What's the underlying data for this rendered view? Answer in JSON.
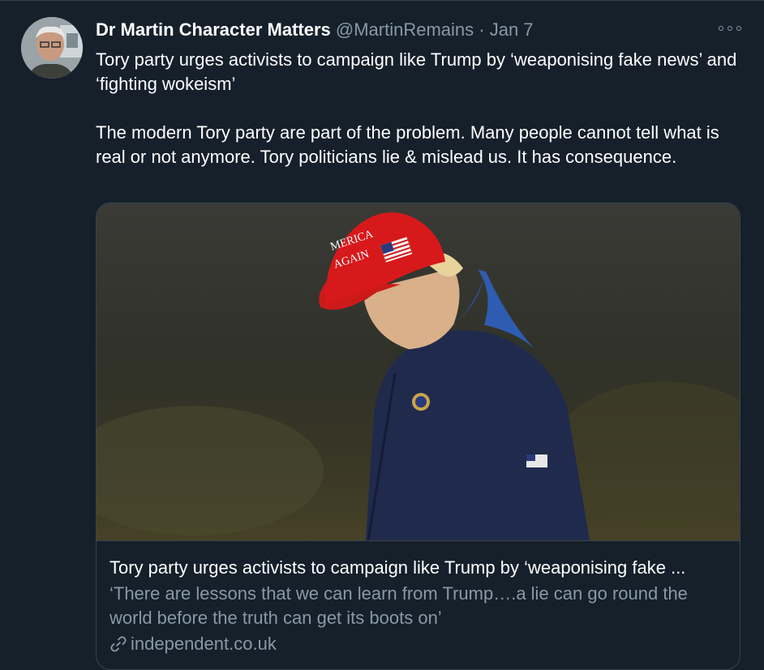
{
  "tweet": {
    "author_name": "Dr Martin Character Matters",
    "handle": "@MartinRemains",
    "separator": "·",
    "date": "Jan 7",
    "text": "Tory party urges activists to campaign like Trump by ‘weaponising fake news’ and ‘fighting wokeism’\n\nThe modern Tory party are part of the problem. Many people cannot tell what is real or not anymore. Tory politicians lie & mislead us. It has consequence."
  },
  "card": {
    "title": "Tory party urges activists to campaign like Trump by ‘weaponising fake ...",
    "description": "‘There are lessons that we can learn from Trump….a lie can go round the world before the truth can get its boots on’",
    "domain": "independent.co.uk",
    "cap_text_line1": "MERICA",
    "cap_text_line2": "AGAIN"
  },
  "icons": {
    "more": "more-options-icon",
    "link": "link-icon"
  },
  "colors": {
    "background": "#15202b",
    "secondary_text": "#8899a6",
    "border": "#38444d"
  }
}
